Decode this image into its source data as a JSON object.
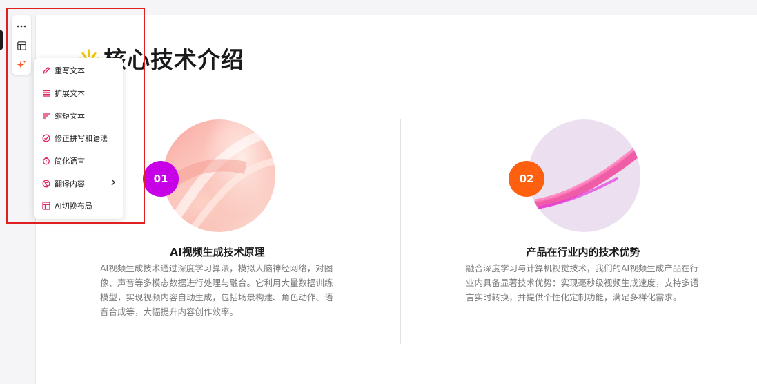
{
  "colors": {
    "badge_1": "#c800e8",
    "badge_2": "#ff6010",
    "menu_icon": "#e0245e",
    "highlight": "#e02020"
  },
  "toolbar": {
    "buttons": [
      {
        "name": "more-icon"
      },
      {
        "name": "layout-icon"
      },
      {
        "name": "ai-sparkle-icon"
      }
    ]
  },
  "ai_menu": {
    "items": [
      {
        "label": "重写文本",
        "icon": "pen-icon"
      },
      {
        "label": "扩展文本",
        "icon": "expand-lines-icon"
      },
      {
        "label": "缩短文本",
        "icon": "shorten-lines-icon"
      },
      {
        "label": "修正拼写和语法",
        "icon": "spellcheck-icon"
      },
      {
        "label": "简化语言",
        "icon": "simplify-icon"
      },
      {
        "label": "翻译内容",
        "icon": "translate-icon",
        "has_submenu": true
      },
      {
        "label": "AI切换布局",
        "icon": "layout-switch-icon"
      }
    ]
  },
  "slide": {
    "title": "核心技术介绍",
    "cards": [
      {
        "number": "01",
        "title": "AI视频生成技术原理",
        "body": "AI视频生成技术通过深度学习算法，模拟人脑神经网络，对图像、声音等多模态数据进行处理与融合。它利用大量数据训练模型，实现视频内容自动生成，包括场景构建、角色动作、语音合成等，大幅提升内容创作效率。"
      },
      {
        "number": "02",
        "title": "产品在行业内的技术优势",
        "body": "融合深度学习与计算机视觉技术，我们的AI视频生成产品在行业内具备显著技术优势：实现毫秒级视频生成速度，支持多语言实时转换，并提供个性化定制功能，满足多样化需求。"
      }
    ]
  }
}
